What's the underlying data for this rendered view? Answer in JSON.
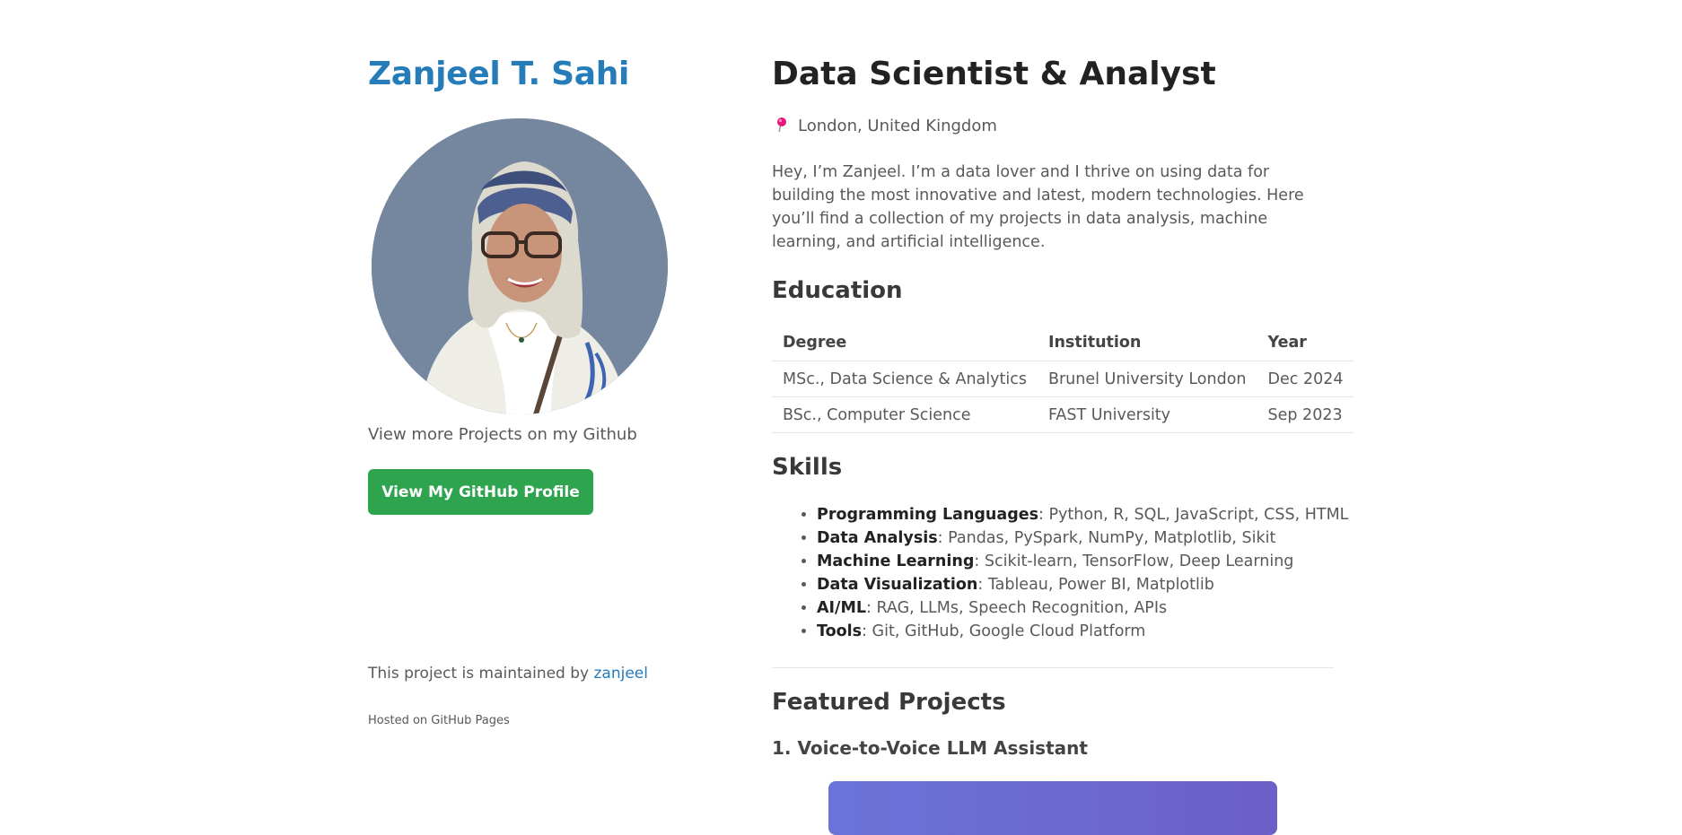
{
  "sidebar": {
    "name": "Zanjeel T. Sahi",
    "view_more_text": "View more Projects on my Github",
    "github_button_label": "View My GitHub Profile",
    "maintained_prefix": "This project is maintained by ",
    "maintained_link": "zanjeel",
    "hosted_text": "Hosted on GitHub Pages"
  },
  "main": {
    "title": "Data Scientist & Analyst",
    "location": "London, United Kingdom",
    "intro": "Hey, I’m Zanjeel. I’m a data lover and I thrive on using data for building the most innovative and latest, modern technologies. Here you’ll find a collection of my projects in data analysis, machine learning, and artificial intelligence.",
    "education": {
      "heading": "Education",
      "columns": [
        "Degree",
        "Institution",
        "Year"
      ],
      "rows": [
        [
          "MSc., Data Science & Analytics",
          "Brunel University London",
          "Dec 2024"
        ],
        [
          "BSc., Computer Science",
          "FAST University",
          "Sep 2023"
        ]
      ]
    },
    "skills": {
      "heading": "Skills",
      "items": [
        {
          "label": "Programming Languages",
          "value": ": Python, R, SQL, JavaScript, CSS, HTML"
        },
        {
          "label": "Data Analysis",
          "value": ": Pandas, PySpark, NumPy, Matplotlib, Sikit"
        },
        {
          "label": "Machine Learning",
          "value": ": Scikit-learn, TensorFlow, Deep Learning"
        },
        {
          "label": "Data Visualization",
          "value": ": Tableau, Power BI, Matplotlib"
        },
        {
          "label": "AI/ML",
          "value": ": RAG, LLMs, Speech Recognition, APIs"
        },
        {
          "label": "Tools",
          "value": ": Git, GitHub, Google Cloud Platform"
        }
      ]
    },
    "featured": {
      "heading": "Featured Projects",
      "project_1_title": "1. Voice-to-Voice LLM Assistant"
    }
  },
  "colors": {
    "link": "#267CB9",
    "button": "#2ea44f",
    "avatar_bg": "#75869f",
    "pin": "#e8157a"
  },
  "icons": {
    "location": "round-pushpin-icon"
  }
}
